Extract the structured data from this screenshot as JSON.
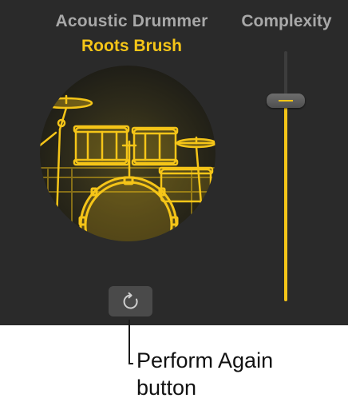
{
  "header": {
    "drummer_name": "Acoustic Drummer",
    "style_name": "Roots Brush"
  },
  "complexity": {
    "label": "Complexity",
    "value_fraction": 0.83
  },
  "perform_again": {
    "icon": "refresh-icon"
  },
  "callout": {
    "line1": "Perform Again",
    "line2": "button"
  },
  "colors": {
    "panel_background": "#2a2a2a",
    "accent_yellow": "#f5c518",
    "label_gray": "#a8a8a8",
    "button_background": "#4a4a4a"
  }
}
